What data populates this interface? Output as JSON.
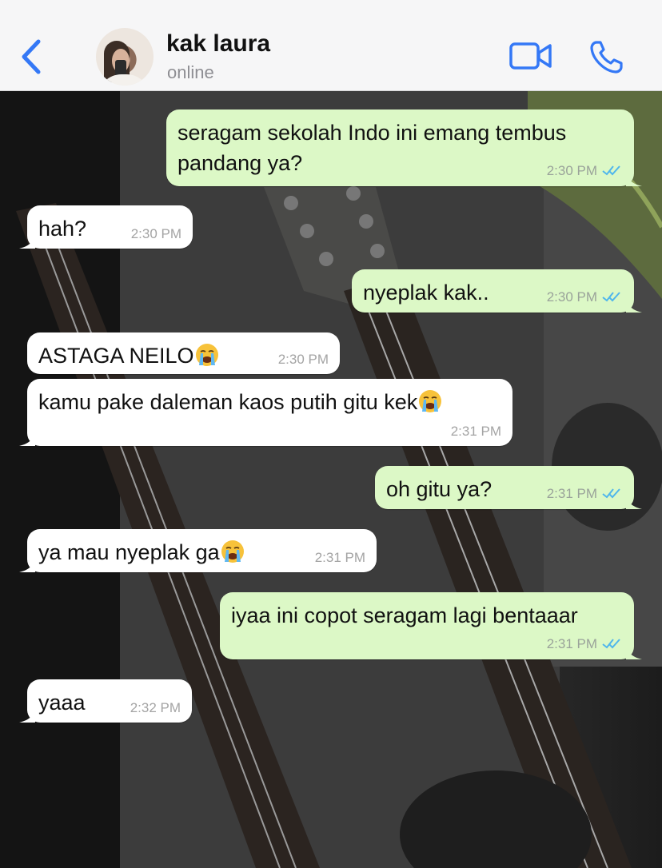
{
  "header": {
    "contact_name": "kak laura",
    "status": "online"
  },
  "icons": {
    "back": "chevron-left-icon",
    "video": "video-camera-icon",
    "call": "phone-icon",
    "read_receipt": "double-check-icon",
    "emoji": "loudly-crying-face-icon"
  },
  "colors": {
    "accent": "#3478f6",
    "outgoing_bubble": "#dcf8c6",
    "incoming_bubble": "#ffffff",
    "read_tick": "#4fb6ec"
  },
  "messages": [
    {
      "direction": "out",
      "text": "seragam sekolah Indo ini emang tembus pandang ya?",
      "time": "2:30 PM",
      "read": true
    },
    {
      "direction": "in",
      "text": "hah?",
      "time": "2:30 PM"
    },
    {
      "direction": "out",
      "text": "nyeplak kak..",
      "time": "2:30 PM",
      "read": true
    },
    {
      "direction": "in",
      "text": "ASTAGA NEILO",
      "emoji": "loudly-crying-face",
      "time": "2:30 PM"
    },
    {
      "direction": "in",
      "text": "kamu pake daleman kaos putih gitu kek",
      "emoji": "loudly-crying-face",
      "time": "2:31 PM"
    },
    {
      "direction": "out",
      "text": "oh gitu ya?",
      "time": "2:31 PM",
      "read": true
    },
    {
      "direction": "in",
      "text": "ya mau nyeplak ga",
      "emoji": "loudly-crying-face",
      "time": "2:31 PM"
    },
    {
      "direction": "out",
      "text": "iyaa ini copot seragam lagi bentaaar",
      "time": "2:31 PM",
      "read": true
    },
    {
      "direction": "in",
      "text": "yaaa",
      "time": "2:32 PM"
    }
  ]
}
